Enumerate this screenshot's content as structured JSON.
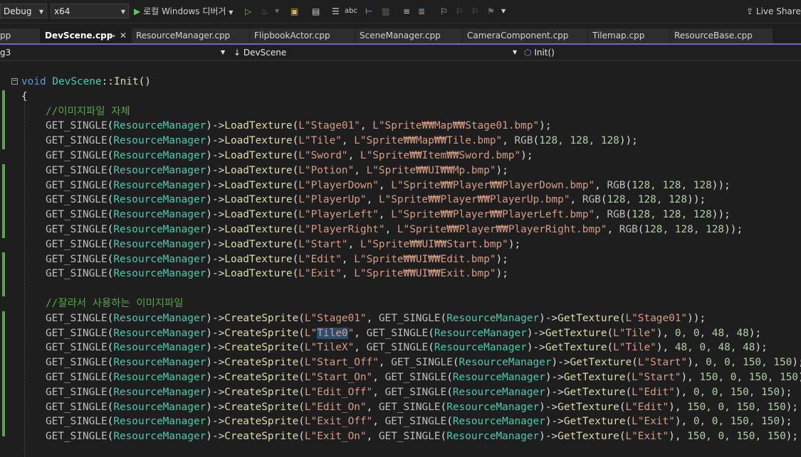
{
  "toolbar": {
    "config": "Debug",
    "platform": "x64",
    "run_label": "로컬 Windows 디버거",
    "share_label": "Live Share"
  },
  "tabs": [
    {
      "label": "pp"
    },
    {
      "label": "DevScene.cpp"
    },
    {
      "label": "ResourceManager.cpp"
    },
    {
      "label": "FlipbookActor.cpp"
    },
    {
      "label": "SceneManager.cpp"
    },
    {
      "label": "CameraComponent.cpp"
    },
    {
      "label": "Tilemap.cpp"
    },
    {
      "label": "ResourceBase.cpp"
    }
  ],
  "navbar": {
    "project": "g3",
    "scope": "DevScene",
    "member": "Init()"
  },
  "code": {
    "fn_keyword": "void",
    "fn_class": "DevScene",
    "fn_sep": "::",
    "fn_name": "Init",
    "fn_parens": "()",
    "open_brace": "{",
    "comment1": "//이미지파일 자체",
    "comment2": "//잘라서 사용하는 이미지파일",
    "macro": "GET_SINGLE",
    "manager": "ResourceManager",
    "load_fn": "LoadTexture",
    "create_fn": "CreateSprite",
    "get_fn": "GetTexture",
    "load_lines": [
      {
        "key": "L\"Stage01\"",
        "path": "L\"Sprite₩₩Map₩₩Stage01.bmp\"",
        "rgb": ""
      },
      {
        "key": "L\"Tile\"",
        "path": "L\"Sprite₩₩Map₩₩Tile.bmp\"",
        "rgb": "128, 128, 128"
      },
      {
        "key": "L\"Sword\"",
        "path": "L\"Sprite₩₩Item₩₩Sword.bmp\"",
        "rgb": ""
      },
      {
        "key": "L\"Potion\"",
        "path": "L\"Sprite₩₩UI₩₩Mp.bmp\"",
        "rgb": ""
      },
      {
        "key": "L\"PlayerDown\"",
        "path": "L\"Sprite₩₩Player₩₩PlayerDown.bmp\"",
        "rgb": "128, 128, 128"
      },
      {
        "key": "L\"PlayerUp\"",
        "path": "L\"Sprite₩₩Player₩₩PlayerUp.bmp\"",
        "rgb": "128, 128, 128"
      },
      {
        "key": "L\"PlayerLeft\"",
        "path": "L\"Sprite₩₩Player₩₩PlayerLeft.bmp\"",
        "rgb": "128, 128, 128"
      },
      {
        "key": "L\"PlayerRight\"",
        "path": "L\"Sprite₩₩Player₩₩PlayerRight.bmp\"",
        "rgb": "128, 128, 128"
      },
      {
        "key": "L\"Start\"",
        "path": "L\"Sprite₩₩UI₩₩Start.bmp\"",
        "rgb": ""
      },
      {
        "key": "L\"Edit\"",
        "path": "L\"Sprite₩₩UI₩₩Edit.bmp\"",
        "rgb": ""
      },
      {
        "key": "L\"Exit\"",
        "path": "L\"Sprite₩₩UI₩₩Exit.bmp\"",
        "rgb": ""
      }
    ],
    "create_lines": [
      {
        "name_pre": "L\"",
        "name_sel": "",
        "name_post": "Stage01\"",
        "tex": "L\"Stage01\"",
        "args": ""
      },
      {
        "name_pre": "L\"",
        "name_sel": "Tile0",
        "name_post": "\"",
        "tex": "L\"Tile\"",
        "args": "0, 0, 48, 48"
      },
      {
        "name_pre": "L\"",
        "name_sel": "",
        "name_post": "TileX\"",
        "tex": "L\"Tile\"",
        "args": "48, 0, 48, 48"
      },
      {
        "name_pre": "L\"",
        "name_sel": "",
        "name_post": "Start_Off\"",
        "tex": "L\"Start\"",
        "args": "0, 0, 150, 150"
      },
      {
        "name_pre": "L\"",
        "name_sel": "",
        "name_post": "Start_On\"",
        "tex": "L\"Start\"",
        "args": "150, 0, 150, 150"
      },
      {
        "name_pre": "L\"",
        "name_sel": "",
        "name_post": "Edit_Off\"",
        "tex": "L\"Edit\"",
        "args": "0, 0, 150, 150"
      },
      {
        "name_pre": "L\"",
        "name_sel": "",
        "name_post": "Edit_On\"",
        "tex": "L\"Edit\"",
        "args": "150, 0, 150, 150"
      },
      {
        "name_pre": "L\"",
        "name_sel": "",
        "name_post": "Exit_Off\"",
        "tex": "L\"Exit\"",
        "args": "0, 0, 150, 150"
      },
      {
        "name_pre": "L\"",
        "name_sel": "",
        "name_post": "Exit_On\"",
        "tex": "L\"Exit\"",
        "args": "150, 0, 150, 150"
      }
    ]
  },
  "colors": {
    "accent": "#7a5fd0",
    "change_bar": "#57a64a",
    "selection": "#264f78"
  }
}
